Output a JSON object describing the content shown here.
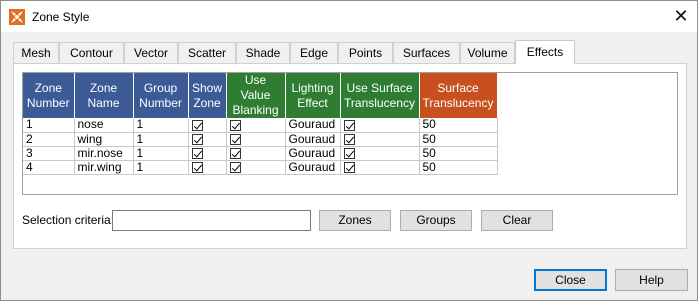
{
  "window": {
    "title": "Zone Style",
    "close_glyph": "✕"
  },
  "tabs": [
    {
      "label": "Mesh"
    },
    {
      "label": "Contour"
    },
    {
      "label": "Vector"
    },
    {
      "label": "Scatter"
    },
    {
      "label": "Shade"
    },
    {
      "label": "Edge"
    },
    {
      "label": "Points"
    },
    {
      "label": "Surfaces"
    },
    {
      "label": "Volume"
    },
    {
      "label": "Effects",
      "active": true
    }
  ],
  "grid": {
    "columns": [
      {
        "line1": "Zone",
        "line2": "Number",
        "color": "#3c5a96"
      },
      {
        "line1": "Zone",
        "line2": "Name",
        "color": "#3c5a96"
      },
      {
        "line1": "Group",
        "line2": "Number",
        "color": "#3c5a96"
      },
      {
        "line1": "Show",
        "line2": "Zone",
        "color": "#3c5a96"
      },
      {
        "line1": "Use Value",
        "line2": "Blanking",
        "color": "#2e7d32"
      },
      {
        "line1": "Lighting",
        "line2": "Effect",
        "color": "#2e7d32"
      },
      {
        "line1": "Use Surface",
        "line2": "Translucency",
        "color": "#2e7d32"
      },
      {
        "line1": "Surface",
        "line2": "Translucency",
        "color": "#c8501e"
      }
    ],
    "rows": [
      {
        "zone_number": "1",
        "zone_name": "nose",
        "group_number": "1",
        "show_zone": true,
        "use_value_blanking": true,
        "lighting_effect": "Gouraud",
        "use_surface_translucency": true,
        "surface_translucency": "50"
      },
      {
        "zone_number": "2",
        "zone_name": "wing",
        "group_number": "1",
        "show_zone": true,
        "use_value_blanking": true,
        "lighting_effect": "Gouraud",
        "use_surface_translucency": true,
        "surface_translucency": "50"
      },
      {
        "zone_number": "3",
        "zone_name": "mir.nose",
        "group_number": "1",
        "show_zone": true,
        "use_value_blanking": true,
        "lighting_effect": "Gouraud",
        "use_surface_translucency": true,
        "surface_translucency": "50"
      },
      {
        "zone_number": "4",
        "zone_name": "mir.wing",
        "group_number": "1",
        "show_zone": true,
        "use_value_blanking": true,
        "lighting_effect": "Gouraud",
        "use_surface_translucency": true,
        "surface_translucency": "50"
      }
    ]
  },
  "selection": {
    "label": "Selection criteria:",
    "value": ""
  },
  "buttons": {
    "zones": "Zones",
    "groups": "Groups",
    "clear": "Clear",
    "close": "Close",
    "help": "Help"
  },
  "icons": {
    "app": "zone-style-app-icon",
    "close": "close-icon",
    "checkbox": "checkmark-icon"
  }
}
